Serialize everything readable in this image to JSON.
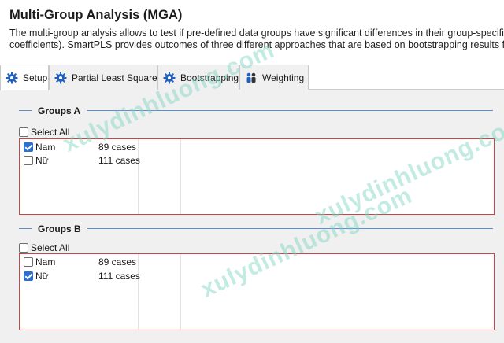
{
  "header": {
    "title": "Multi-Group Analysis (MGA)",
    "description_line1": "The multi-group analysis allows to test if pre-defined data groups have significant differences in their group-specific",
    "description_line2": "coefficients). SmartPLS provides outcomes of three different approaches that are based on bootstrapping results fr"
  },
  "tabs": [
    {
      "label": "Setup",
      "icon": "gear-icon",
      "active": true
    },
    {
      "label": "Partial Least Squares",
      "icon": "gear-icon",
      "active": false
    },
    {
      "label": "Bootstrapping",
      "icon": "gear-icon",
      "active": false
    },
    {
      "label": "Weighting",
      "icon": "people-icon",
      "active": false
    }
  ],
  "groups_a": {
    "title": "Groups A",
    "select_all_label": "Select All",
    "select_all_checked": false,
    "rows": [
      {
        "name": "Nam",
        "cases": "89 cases",
        "checked": true
      },
      {
        "name": "Nữ",
        "cases": "111 cases",
        "checked": false
      }
    ]
  },
  "groups_b": {
    "title": "Groups B",
    "select_all_label": "Select All",
    "select_all_checked": false,
    "rows": [
      {
        "name": "Nam",
        "cases": "89 cases",
        "checked": false
      },
      {
        "name": "Nữ",
        "cases": "111 cases",
        "checked": true
      }
    ]
  },
  "watermarks": [
    "xulydinhluong.com",
    "xulydinhluong.com",
    "xulydinhluong.com"
  ],
  "colors": {
    "accent": "#2c6fd1",
    "section_line": "#5a8fd0",
    "listbox_border": "#c94545",
    "panel_bg": "#f0f0f0"
  }
}
